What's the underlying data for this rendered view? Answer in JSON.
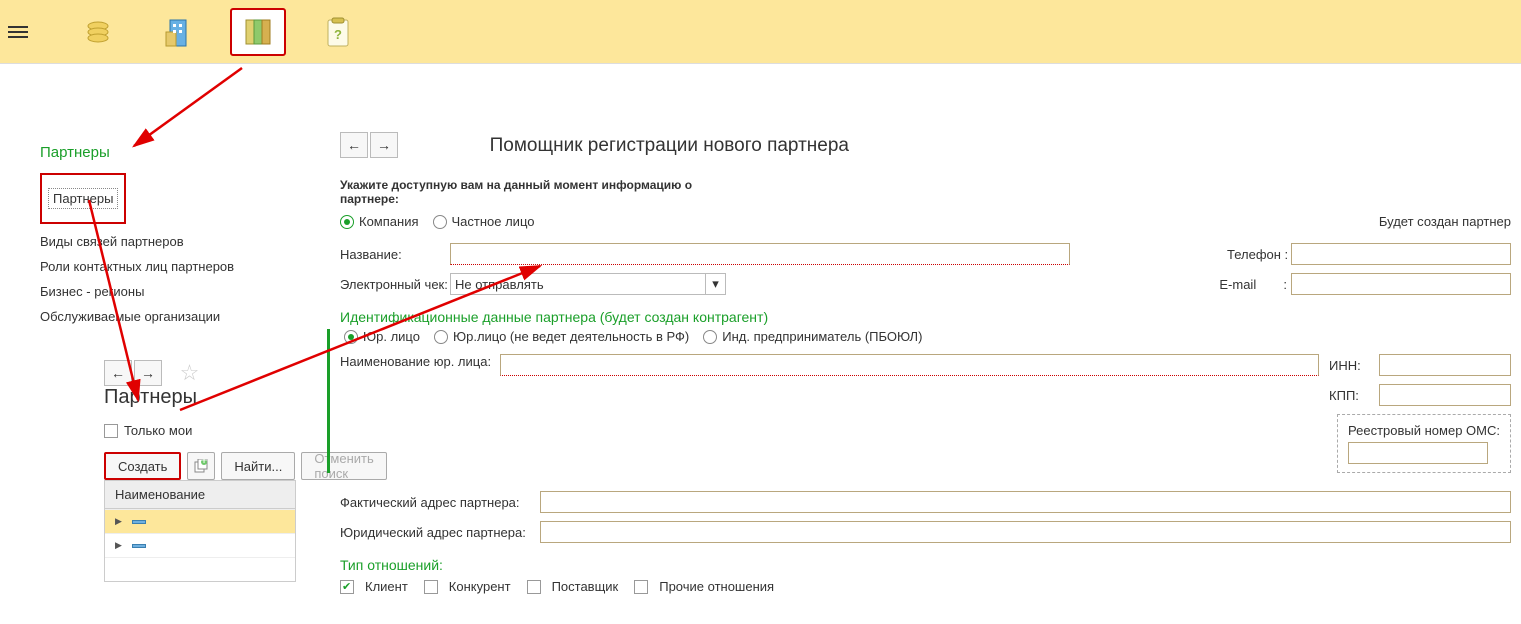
{
  "toolbar": {
    "icons": [
      "finance",
      "building",
      "books",
      "help"
    ]
  },
  "leftnav": {
    "title": "Партнеры",
    "items": [
      "Партнеры",
      "Виды связей партнеров",
      "Роли контактных лиц партнеров",
      "Бизнес - регионы",
      "Обслуживаемые организации"
    ]
  },
  "subpanel": {
    "title": "Партнеры",
    "only_mine": "Только мои",
    "btn_create": "Создать",
    "btn_find": "Найти...",
    "btn_cancel_search": "Отменить поиск",
    "grid_header": "Наименование"
  },
  "form": {
    "title": "Помощник регистрации нового партнера",
    "hint": "Укажите доступную вам на данный момент информацию о партнере:",
    "radio_company": "Компания",
    "radio_private": "Частное лицо",
    "status": "Будет создан партнер",
    "label_name": "Название:",
    "label_phone": "Телефон :",
    "label_echeck": "Электронный чек:",
    "echeck_value": "Не отправлять",
    "label_email": "E-mail",
    "section_ident": "Идентификационные данные партнера (будет создан контрагент)",
    "radio_legal": "Юр. лицо",
    "radio_legal_norf": "Юр.лицо (не ведет деятельность в РФ)",
    "radio_ip": "Инд. предприниматель (ПБОЮЛ)",
    "label_legal_name": "Наименование юр. лица:",
    "label_inn": "ИНН:",
    "label_kpp": "КПП:",
    "label_oms": "Реестровый номер ОМС:",
    "label_fact_addr": "Фактический адрес партнера:",
    "label_legal_addr": "Юридический адрес партнера:",
    "section_rel": "Тип отношений:",
    "cb_client": "Клиент",
    "cb_competitor": "Конкурент",
    "cb_supplier": "Поставщик",
    "cb_other": "Прочие отношения"
  }
}
